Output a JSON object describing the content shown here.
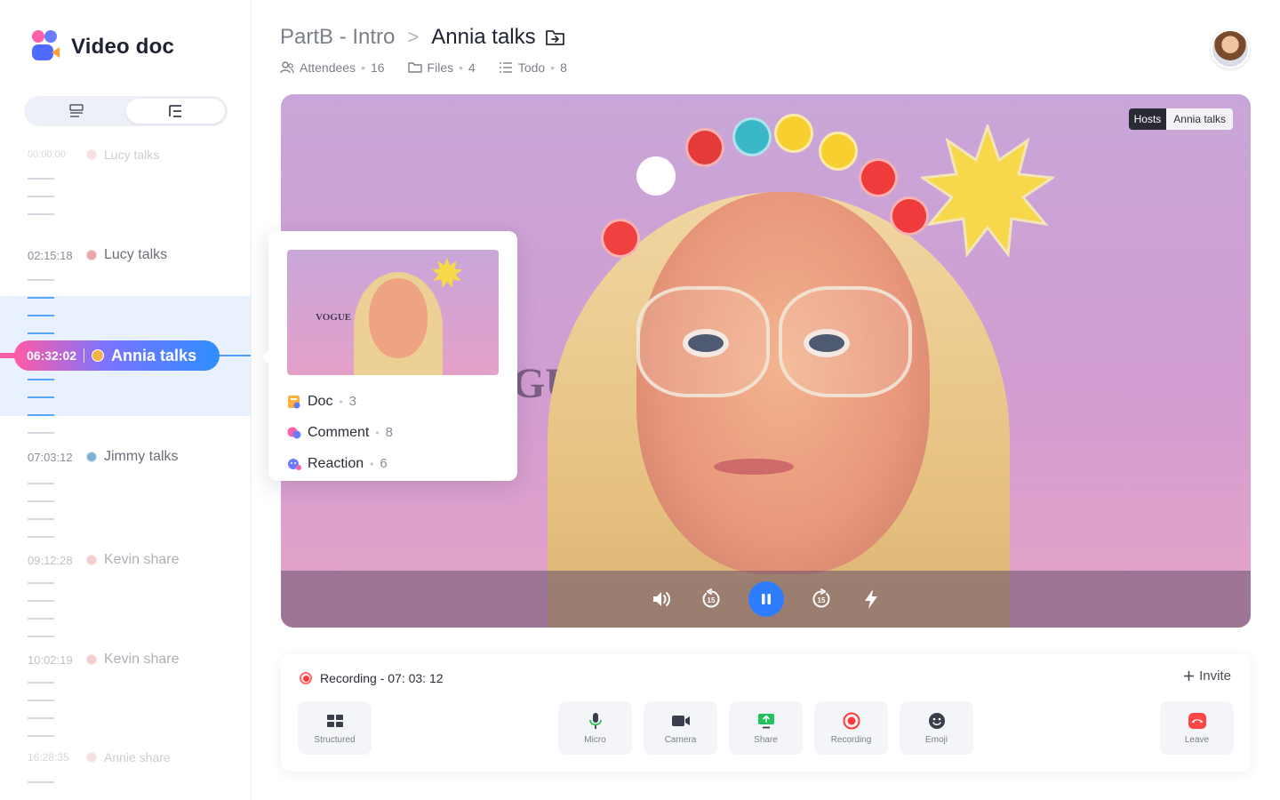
{
  "app": {
    "name": "Video doc"
  },
  "view_toggle": {
    "options": [
      "list-view",
      "outline-view"
    ],
    "selected": "outline-view"
  },
  "timeline": {
    "entries": [
      {
        "time": "00:00:00",
        "name": "Lucy talks",
        "state": "faded"
      },
      {
        "time": "02:15:18",
        "name": "Lucy talks",
        "state": "normal"
      },
      {
        "time": "06:32:02",
        "name": "Annia talks",
        "state": "active"
      },
      {
        "time": "07:03:12",
        "name": "Jimmy talks",
        "state": "normal"
      },
      {
        "time": "09:12:28",
        "name": "Kevin share",
        "state": "dim"
      },
      {
        "time": "10:02:19",
        "name": "Kevin share",
        "state": "dim"
      },
      {
        "time": "16:28:35",
        "name": "Annie share",
        "state": "faded"
      }
    ]
  },
  "header": {
    "breadcrumb_parent": "PartB - Intro",
    "breadcrumb_separator": ">",
    "breadcrumb_current": "Annia talks",
    "meta": [
      {
        "label": "Attendees",
        "count": "16",
        "icon": "attendees-icon"
      },
      {
        "label": "Files",
        "count": "4",
        "icon": "folder-icon"
      },
      {
        "label": "Todo",
        "count": "8",
        "icon": "todo-list-icon"
      }
    ]
  },
  "video": {
    "host_label": "Hosts",
    "host_name": "Annia talks",
    "background_text": "GUE",
    "controls": [
      "volume-icon",
      "rewind-15-icon",
      "pause-icon",
      "forward-15-icon",
      "flash-icon"
    ]
  },
  "popover": {
    "thumbnail_text": "VOGUE",
    "items": [
      {
        "label": "Doc",
        "count": "3",
        "color": "#ff9d2f"
      },
      {
        "label": "Comment",
        "count": "8",
        "color": "#ff5ea8"
      },
      {
        "label": "Reaction",
        "count": "6",
        "color": "#6c7cff"
      }
    ]
  },
  "panel": {
    "recording_status": "Recording - 07: 03: 12",
    "invite_label": "Invite",
    "tools": {
      "structured": "Structured",
      "micro": "Micro",
      "camera": "Camera",
      "share": "Share",
      "recording": "Recording",
      "emoji": "Emoji",
      "leave": "Leave"
    }
  },
  "colors": {
    "accent": "#2f7dff",
    "pink": "#ff5ea8",
    "record": "#ff3b3b",
    "share": "#22c25a"
  }
}
